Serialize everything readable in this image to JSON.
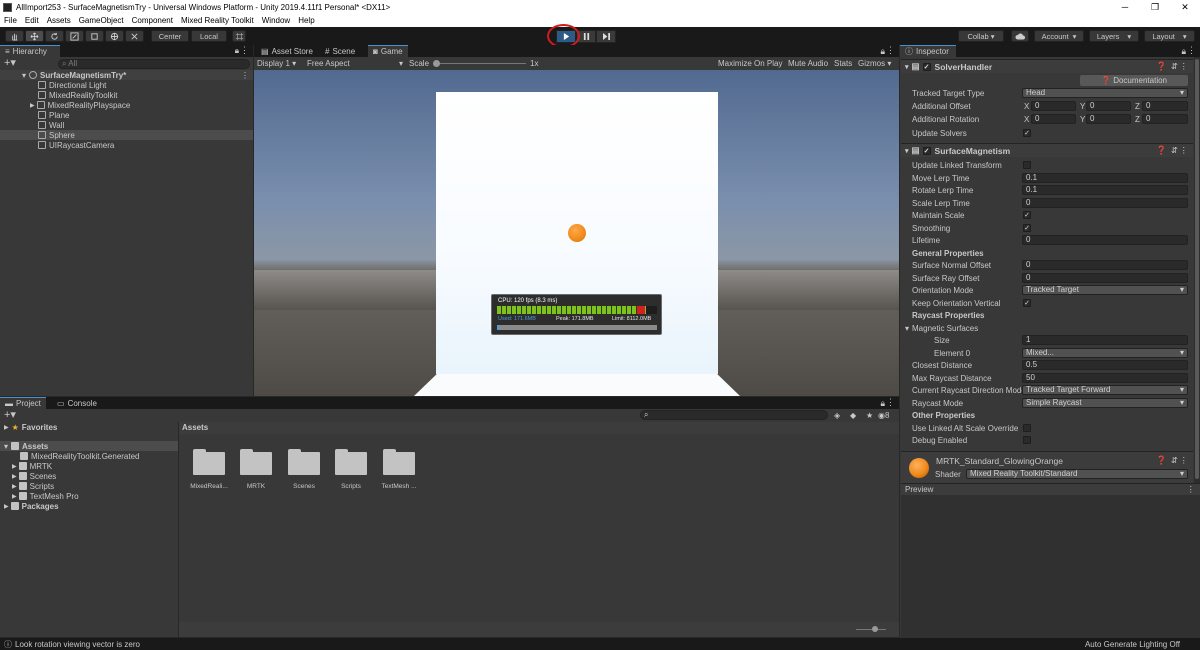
{
  "window": {
    "title": "AllImport253 - SurfaceMagnetismTry - Universal Windows Platform - Unity 2019.4.11f1 Personal* <DX11>",
    "controls": [
      "─",
      "❐",
      "✕"
    ]
  },
  "menu": [
    "File",
    "Edit",
    "Assets",
    "GameObject",
    "Component",
    "Mixed Reality Toolkit",
    "Window",
    "Help"
  ],
  "toolbar": {
    "center_label": "Center",
    "local_label": "Local",
    "collab_label": "Collab ▾",
    "account_label": "Account",
    "layers_label": "Layers",
    "layout_label": "Layout"
  },
  "hierarchy": {
    "tab": "Hierarchy",
    "search_placeholder": "All",
    "scene": "SurfaceMagnetismTry*",
    "items": [
      "Directional Light",
      "MixedRealityToolkit",
      "MixedRealityPlayspace",
      "Plane",
      "Wall",
      "Sphere",
      "UIRaycastCamera"
    ]
  },
  "center_tabs": [
    "Asset Store",
    "Scene",
    "Game"
  ],
  "game_bar": {
    "display": "Display 1",
    "aspect": "Free Aspect",
    "scale_label": "Scale",
    "scale_value": "1x",
    "maximize": "Maximize On Play",
    "mute": "Mute Audio",
    "stats": "Stats",
    "gizmos": "Gizmos"
  },
  "profiler": {
    "cpu": "CPU: 120 fps (8.3 ms)",
    "used": "Used: 171.6MB",
    "peak": "Peak: 171.8MB",
    "limit": "Limit: 8112.0MB",
    "fps_filled_fraction": 0.93
  },
  "project": {
    "tabs": [
      "Project",
      "Console"
    ],
    "favorites": "Favorites",
    "assets_root": "Assets",
    "tree": [
      "MixedRealityToolkit.Generated",
      "MRTK",
      "Scenes",
      "Scripts",
      "TextMesh Pro"
    ],
    "packages": "Packages",
    "breadcrumb": "Assets",
    "folders": [
      "MixedReali...",
      "MRTK",
      "Scenes",
      "Scripts",
      "TextMesh ..."
    ],
    "hidden_count": "8"
  },
  "inspector": {
    "tab": "Inspector",
    "solver_handler": {
      "title": "SolverHandler",
      "doc_button": "Documentation",
      "tracked_target_type": {
        "label": "Tracked Target Type",
        "value": "Head"
      },
      "additional_offset": {
        "label": "Additional Offset",
        "x": "0",
        "y": "0",
        "z": "0"
      },
      "additional_rotation": {
        "label": "Additional Rotation",
        "x": "0",
        "y": "0",
        "z": "0"
      },
      "update_solvers": {
        "label": "Update Solvers",
        "checked": "✓"
      }
    },
    "surface_magnetism": {
      "title": "SurfaceMagnetism",
      "rows": [
        {
          "label": "Update Linked Transform",
          "kind": "check",
          "value": ""
        },
        {
          "label": "Move Lerp Time",
          "kind": "field",
          "value": "0.1"
        },
        {
          "label": "Rotate Lerp Time",
          "kind": "field",
          "value": "0.1"
        },
        {
          "label": "Scale Lerp Time",
          "kind": "field",
          "value": "0"
        },
        {
          "label": "Maintain Scale",
          "kind": "check",
          "value": "✓"
        },
        {
          "label": "Smoothing",
          "kind": "check",
          "value": "✓"
        },
        {
          "label": "Lifetime",
          "kind": "field",
          "value": "0"
        },
        {
          "label": "General Properties",
          "kind": "header",
          "value": ""
        },
        {
          "label": "Surface Normal Offset",
          "kind": "field",
          "value": "0"
        },
        {
          "label": "Surface Ray Offset",
          "kind": "field",
          "value": "0"
        },
        {
          "label": "Orientation Mode",
          "kind": "dropdown",
          "value": "Tracked Target"
        },
        {
          "label": "Keep Orientation Vertical",
          "kind": "check",
          "value": "✓"
        },
        {
          "label": "Raycast Properties",
          "kind": "header",
          "value": ""
        },
        {
          "label": "Magnetic Surfaces",
          "kind": "foldout",
          "value": ""
        },
        {
          "label": "Size",
          "kind": "field-indent",
          "value": "1"
        },
        {
          "label": "Element 0",
          "kind": "dropdown-indent",
          "value": "Mixed..."
        },
        {
          "label": "Closest Distance",
          "kind": "field",
          "value": "0.5"
        },
        {
          "label": "Max Raycast Distance",
          "kind": "field",
          "value": "50"
        },
        {
          "label": "Current Raycast Direction Mode",
          "kind": "dropdown",
          "value": "Tracked Target Forward"
        },
        {
          "label": "Raycast Mode",
          "kind": "dropdown",
          "value": "Simple Raycast"
        },
        {
          "label": "Other Properties",
          "kind": "header",
          "value": ""
        },
        {
          "label": "Use Linked Alt Scale Override",
          "kind": "check",
          "value": ""
        },
        {
          "label": "Debug Enabled",
          "kind": "check",
          "value": ""
        }
      ]
    },
    "material": {
      "name": "MRTK_Standard_GlowingOrange",
      "shader_label": "Shader",
      "shader_value": "Mixed Reality Toolkit/Standard"
    },
    "preview_label": "Preview"
  },
  "status": {
    "message": "Look rotation viewing vector is zero",
    "right": "Auto Generate Lighting Off"
  },
  "colors": {
    "accent": "#4a8fd0",
    "play_active": "#2e5b86",
    "highlight_ring": "#d01c1c",
    "sphere": "#f08a1a",
    "profiler_bar": "#7fc21e"
  }
}
